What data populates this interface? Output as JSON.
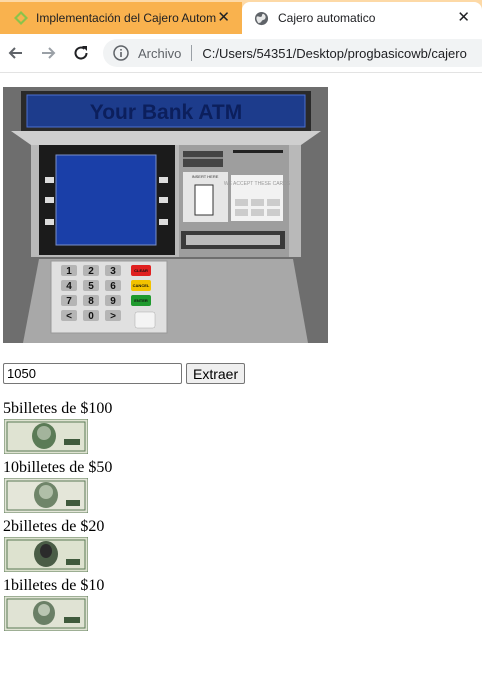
{
  "browser": {
    "tabs": [
      {
        "title": "Implementación del Cajero Autom",
        "active": false,
        "favicon": "diamond-icon"
      },
      {
        "title": "Cajero automatico",
        "active": true,
        "favicon": "globe-icon"
      }
    ],
    "close_glyph": "✕",
    "address": {
      "security_label": "Archivo",
      "url": "C:/Users/54351/Desktop/progbasicowb/cajero"
    }
  },
  "atm": {
    "screen_title": "Your Bank ATM",
    "card_slot_label": "INSERT HERE",
    "accepted_cards_label": "WE ACCEPT THESE CARDS",
    "keypad": [
      "1",
      "2",
      "3",
      "4",
      "5",
      "6",
      "7",
      "8",
      "9",
      "<",
      "0",
      ">"
    ],
    "function_keys": [
      "CLEAR",
      "CANCEL",
      "ENTER"
    ]
  },
  "form": {
    "amount_value": "1050",
    "submit_label": "Extraer"
  },
  "results": [
    {
      "text": "5billetes de $100",
      "denomination": "100"
    },
    {
      "text": "10billetes de $50",
      "denomination": "50"
    },
    {
      "text": "2billetes de $20",
      "denomination": "20"
    },
    {
      "text": "1billetes de $10",
      "denomination": "10"
    }
  ],
  "colors": {
    "tabbar": "#fdd9a6",
    "inactive_tab": "#f9b24e",
    "bill_green": "#5b7b56",
    "atm_screen": "#1a3fa8"
  }
}
